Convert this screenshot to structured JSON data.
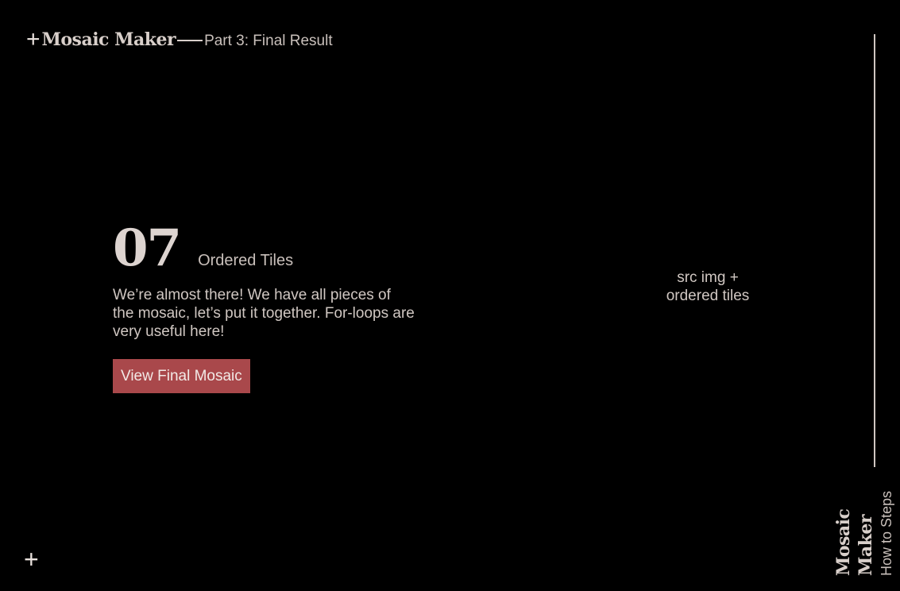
{
  "header": {
    "plus_symbol": "+",
    "brand": "Mosaic Maker",
    "subtitle": "Part 3: Final Result"
  },
  "step": {
    "number": "07",
    "title": "Ordered Tiles",
    "description": "We’re almost there! We have all pieces of the mosaic, let’s put it together. For-loops are very useful here!",
    "button_label": "View Final Mosaic"
  },
  "preview": {
    "line1": "src img +",
    "line2": "ordered tiles"
  },
  "side": {
    "brand": "Mosaic Maker",
    "subtitle": "How to Steps"
  },
  "footer": {
    "plus_symbol": "+"
  },
  "colors": {
    "background": "#000000",
    "text": "#d8cfca",
    "accent_button": "#a9484b"
  }
}
